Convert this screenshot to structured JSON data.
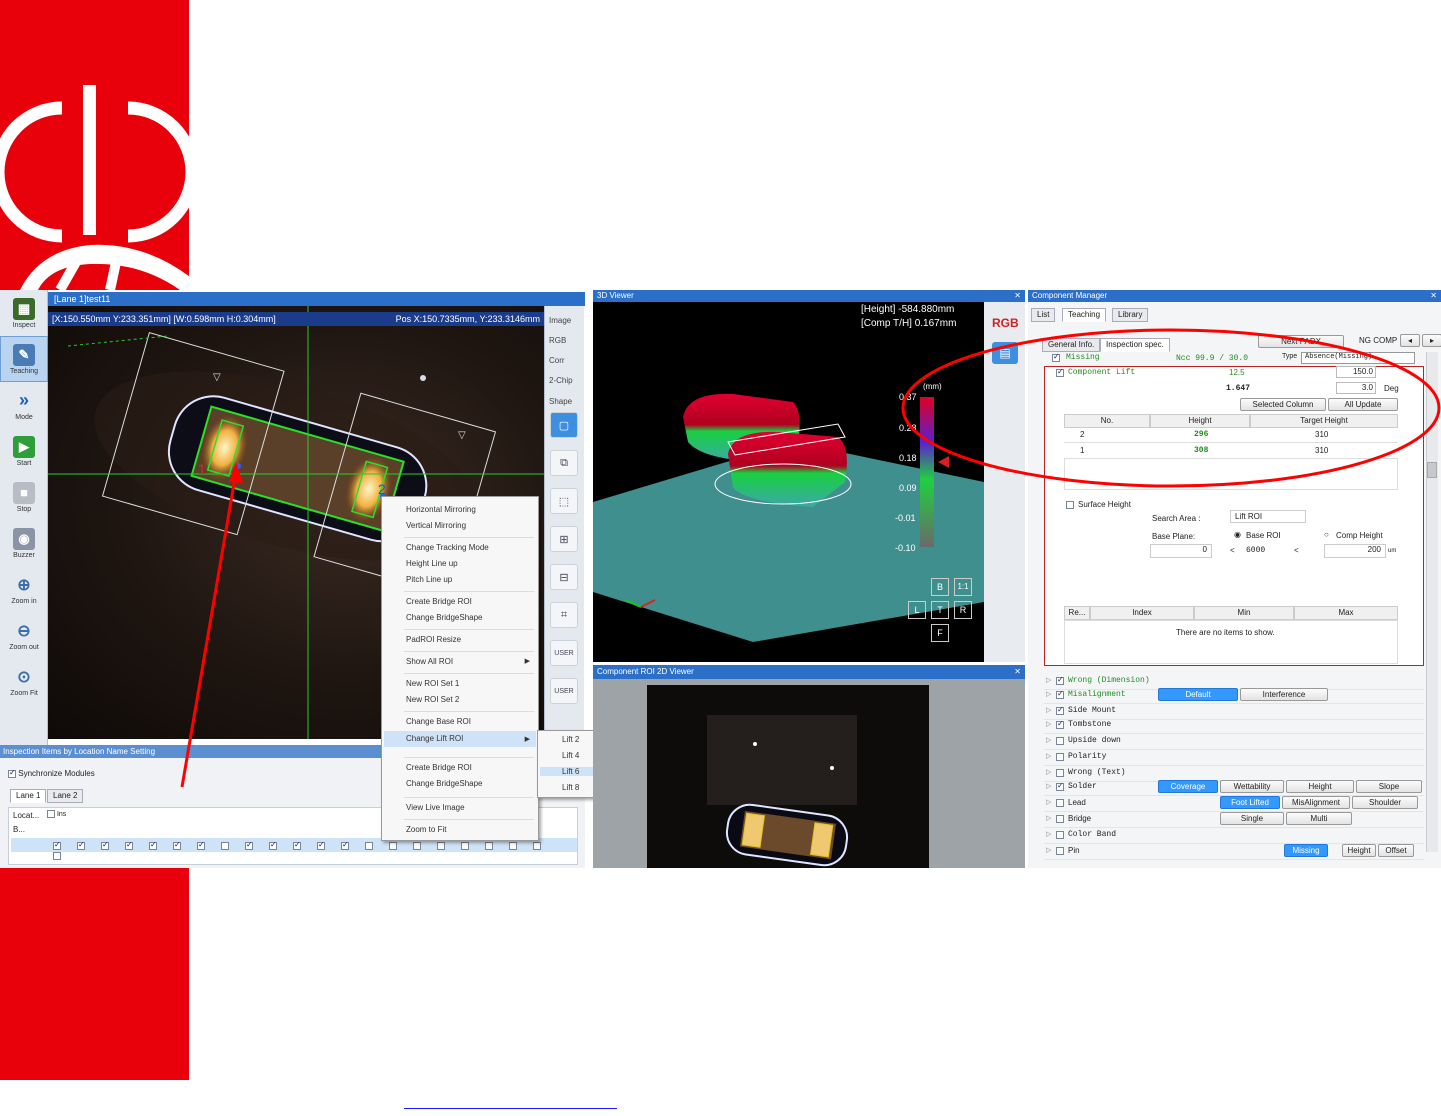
{
  "colors": {
    "brand_red": "#e8000a",
    "title_blue": "#2b6fc8",
    "annotation_red": "#ff0000"
  },
  "toolbar": {
    "items": [
      {
        "label": "Inspect",
        "icon": "pcb-board-icon"
      },
      {
        "label": "Teaching",
        "icon": "teaching-icon",
        "selected": true
      },
      {
        "label": "Mode",
        "icon": "chevrons-right-icon"
      },
      {
        "label": "Start",
        "icon": "play-icon"
      },
      {
        "label": "Stop",
        "icon": "stop-icon"
      },
      {
        "label": "Buzzer",
        "icon": "buzzer-icon"
      },
      {
        "label": "Zoom in",
        "icon": "zoom-in-icon"
      },
      {
        "label": "Zoom out",
        "icon": "zoom-out-icon"
      },
      {
        "label": "Zoom Fit",
        "icon": "zoom-fit-icon"
      }
    ]
  },
  "main": {
    "title": "[Lane 1]test11",
    "coords": "[X:150.550mm Y:233.351mm] [W:0.598mm H:0.304mm]",
    "pos": "Pos X:150.7335mm, Y:233.3146mm",
    "pad_left_num": "1",
    "pad_right_num": "2",
    "arrow_glyph": "▽"
  },
  "right_strip": {
    "image_label": "Image",
    "rgb_label": "RGB",
    "corr_label": "Corr",
    "chip_label": "2-Chip",
    "shape_label": "Shape",
    "user1": "USER",
    "user2": "USER"
  },
  "context_menu": {
    "items": [
      "Horizontal Mirroring",
      "Vertical Mirroring",
      "Change Tracking Mode",
      "Height Line up",
      "Pitch Line up",
      "Create Bridge ROI",
      "Change BridgeShape",
      "PadROI Resize",
      "Show All ROI",
      "New ROI Set 1",
      "New ROI Set 2",
      "Change Base ROI",
      "Change Lift ROI",
      "Create Bridge ROI",
      "Change BridgeShape",
      "View Live Image",
      "Zoom to Fit"
    ],
    "submenu": [
      "Lift 2",
      "Lift 4",
      "Lift 6",
      "Lift 8"
    ]
  },
  "inspection_panel": {
    "title": "Inspection Items by Location Name Setting",
    "sync_label": "Synchronize Modules",
    "lanes": [
      "Lane 1",
      "Lane 2"
    ],
    "loc_label": "Locat...",
    "ins_label": "Ins",
    "b_label": "B..."
  },
  "viewer3d": {
    "title": "3D Viewer",
    "height_text": "[Height] -584.880mm",
    "comp_text": "[Comp T/H]  0.167mm",
    "scale_unit": "(mm)",
    "scale_ticks": [
      "0.37",
      "0.28",
      "0.18",
      "0.09",
      "-0.01",
      "-0.10"
    ],
    "rgb_label": "RGB",
    "view_buttons": [
      "B",
      "1:1",
      "L",
      "T",
      "R",
      "F"
    ]
  },
  "viewer2d": {
    "title": "Component ROI 2D Viewer"
  },
  "component_manager": {
    "title": "Component Manager",
    "tabs": [
      "List",
      "Teaching",
      "Library"
    ],
    "subtabs": [
      "General Info.",
      "Inspection spec."
    ],
    "next_btn": "Next PADX",
    "ng_comp_label": "NG COMP",
    "missing_label": "Missing",
    "missing_ncc": "Ncc 99.9 / 30.0",
    "type_label": "Type",
    "type_value": "Absence(Missing)",
    "lift_label": "Component  Lift",
    "lift_val": "12.5",
    "lift_val2": "150.0",
    "lift_sub": "1.647",
    "lift_deg": "3.0",
    "deg_label": "Deg",
    "selected_col_btn": "Selected Column",
    "all_update_btn": "All Update",
    "table_headers": [
      "No.",
      "Height",
      "Target Height"
    ],
    "table_rows": [
      {
        "no": "2",
        "height": "296",
        "target": "310"
      },
      {
        "no": "1",
        "height": "308",
        "target": "310"
      }
    ],
    "surface_height": "Surface Height",
    "search_area_label": "Search Area :",
    "search_area_value": "Lift ROI",
    "base_plane_label": "Base Plane:",
    "base_roi": "Base ROI",
    "comp_height": "Comp Height",
    "range_min": "0",
    "range_max": "6000",
    "range_op": "<",
    "comp_value": "200",
    "comp_unit": "um",
    "res_headers": [
      "Re...",
      "Index",
      "Min",
      "Max"
    ],
    "empty_text": "There are no items to show.",
    "items": [
      {
        "label": "Wrong (Dimension)",
        "mono": true,
        "checked": true,
        "color": "#228b22"
      },
      {
        "label": "Misalignment",
        "mono": true,
        "checked": true,
        "color": "#228b22"
      },
      {
        "label": "Side Mount",
        "mono": true,
        "checked": true,
        "color": "#222"
      },
      {
        "label": "Tombstone",
        "mono": true,
        "checked": true,
        "color": "#222"
      },
      {
        "label": "Upside down",
        "mono": true,
        "checked": false,
        "color": "#222"
      },
      {
        "label": "Polarity",
        "mono": true,
        "checked": false,
        "color": "#222"
      },
      {
        "label": "Wrong (Text)",
        "mono": true,
        "checked": false,
        "color": "#222"
      },
      {
        "label": "Solder",
        "mono": true,
        "checked": true,
        "color": "#222"
      },
      {
        "label": "Lead",
        "mono": false,
        "checked": false,
        "color": "#222"
      },
      {
        "label": "Bridge",
        "mono": false,
        "checked": false,
        "color": "#222"
      },
      {
        "label": "Color Band",
        "mono": true,
        "checked": false,
        "color": "#222"
      },
      {
        "label": "Pin",
        "mono": false,
        "checked": false,
        "color": "#222"
      }
    ],
    "misalign_btns": [
      "Default",
      "Interference"
    ],
    "solder_btns": [
      "Coverage",
      "Wettability",
      "Height",
      "Slope"
    ],
    "lead_btns": [
      "Foot Lifted",
      "MisAlignment",
      "Shoulder"
    ],
    "bridge_btns": [
      "Single",
      "Multi"
    ],
    "pin_btns": [
      "Missing",
      "Height",
      "Offset"
    ]
  }
}
